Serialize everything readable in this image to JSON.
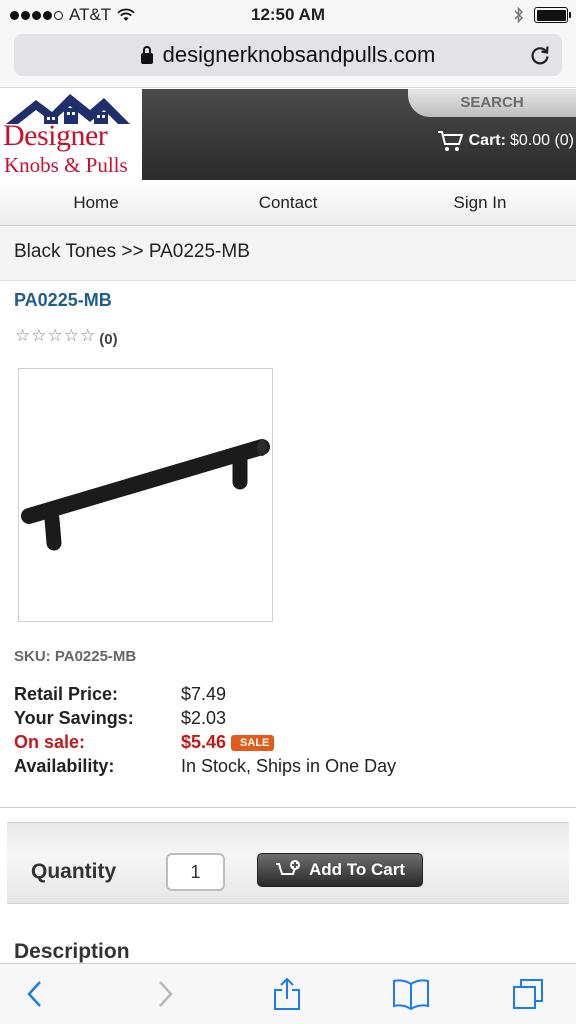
{
  "status": {
    "carrier": "AT&T",
    "time": "12:50 AM"
  },
  "browser": {
    "url": "designerknobsandpulls.com"
  },
  "site": {
    "logo_line1": "Designer",
    "logo_line2": "Knobs & Pulls",
    "search_label": "SEARCH",
    "cart_label": "Cart:",
    "cart_total": "$0.00 (0)"
  },
  "nav": {
    "home": "Home",
    "contact": "Contact",
    "sign_in": "Sign In"
  },
  "breadcrumb": "Black Tones >> PA0225-MB",
  "product": {
    "title": "PA0225-MB",
    "rating_count": "(0)",
    "stars_filled": 0,
    "sku_label": "SKU:",
    "sku": "PA0225-MB",
    "retail_label": "Retail Price:",
    "retail_price": "$7.49",
    "savings_label": "Your Savings:",
    "savings": "$2.03",
    "sale_label": "On sale:",
    "sale_price": "$5.46",
    "sale_badge": "SALE",
    "availability_label": "Availability:",
    "availability": "In Stock, Ships in One Day"
  },
  "purchase": {
    "quantity_label": "Quantity",
    "quantity": "1",
    "add_to_cart": "Add To Cart"
  },
  "description_heading": "Description",
  "colors": {
    "brand_red": "#c8102e",
    "link_blue": "#1f5d8c",
    "sale_red": "#c21a1a",
    "ios_blue": "#1a7cf5"
  }
}
